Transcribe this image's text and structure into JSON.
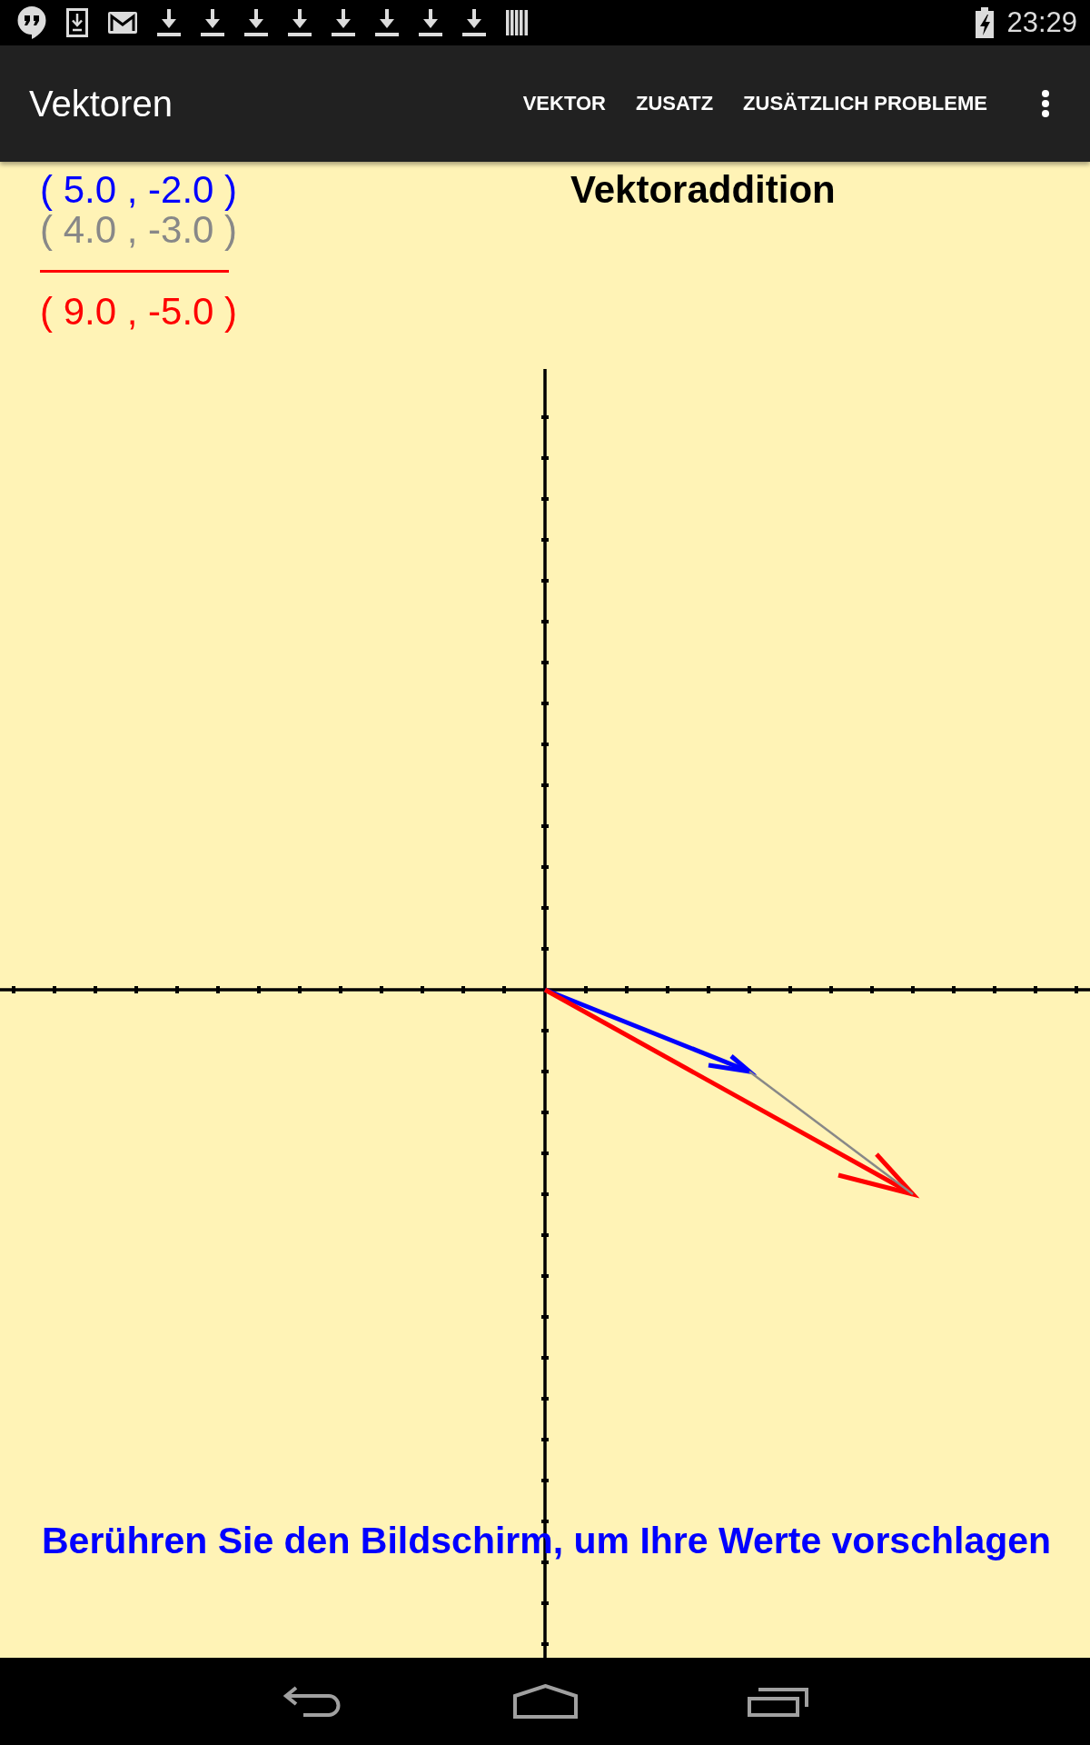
{
  "status_bar": {
    "time": "23:29"
  },
  "action_bar": {
    "title": "Vektoren",
    "actions": [
      "VEKTOR",
      "ZUSATZ",
      "ZUSÄTZLICH PROBLEME"
    ]
  },
  "canvas": {
    "vectors": [
      {
        "kind": "summand",
        "text": "( 5.0 , -2.0 )",
        "color": "#0000ff"
      },
      {
        "kind": "summand",
        "text": "( 4.0 , -3.0 )",
        "color": "#888888"
      },
      {
        "kind": "sum",
        "text": "( 9.0 , -5.0 )",
        "color": "#ff0000"
      }
    ],
    "title": "Vektoraddition",
    "hint": "Berühren Sie den Bildschirm, um Ihre Werte vorschlagen"
  }
}
